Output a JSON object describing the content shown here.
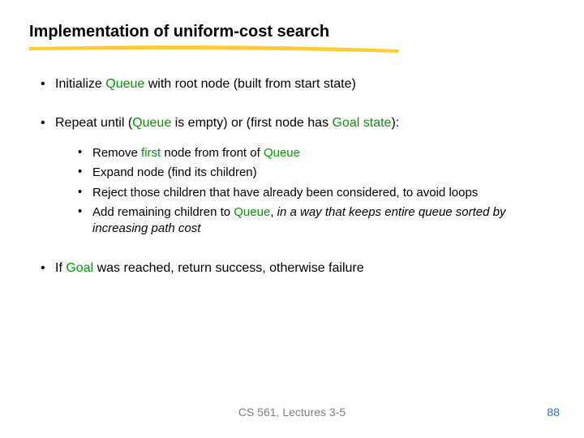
{
  "title": "Implementation of uniform-cost search",
  "b1": {
    "pre": "Initialize ",
    "q": "Queue",
    "post": " with root node (built from start state)"
  },
  "b2": {
    "pre": "Repeat until (",
    "q": "Queue",
    "mid": " is empty) or (first node has ",
    "g": "Goal state",
    "post": "):"
  },
  "s1": {
    "pre": "Remove ",
    "f": "first",
    " post_pre": " node from front of ",
    "q": "Queue"
  },
  "s1_post_pre": " node from front of ",
  "s2": "Expand node (find its children)",
  "s3": "Reject those children that have already been considered, to avoid loops",
  "s4": {
    "pre": "Add remaining children to ",
    "q": "Queue",
    "mid": ", ",
    "em": "in a way that keeps entire queue sorted by increasing path cost"
  },
  "b3": {
    "pre": "If ",
    "g": "Goal",
    "post": " was reached, return success, otherwise failure"
  },
  "footer": "CS 561, Lectures 3-5",
  "page": "88",
  "dot": "•"
}
